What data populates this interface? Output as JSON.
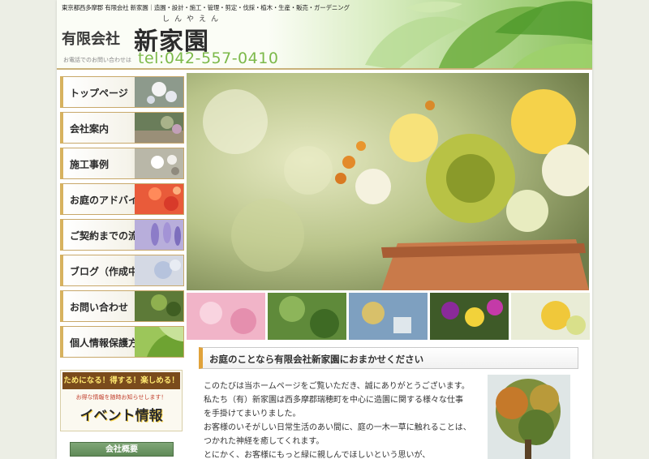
{
  "header": {
    "tagline": "東京都西多摩郡 有限会社 新家園｜造園・設計・施工・管理・剪定・伐採・植木・生産・販売・ガーデニング",
    "company_prefix": "有限会社",
    "company_name": "新家園",
    "furigana": "しんやえん",
    "tel_label": "お電話でのお問い合わせは",
    "tel_number": "tel:042-557-0410"
  },
  "nav": {
    "items": [
      {
        "label": "トップページ"
      },
      {
        "label": "会社案内"
      },
      {
        "label": "施工事例"
      },
      {
        "label": "お庭のアドバイス"
      },
      {
        "label": "ご契約までの流れ"
      },
      {
        "label": "ブログ（作成中）"
      },
      {
        "label": "お問い合わせ"
      },
      {
        "label": "個人情報保護方針"
      }
    ]
  },
  "banner": {
    "top": "ためになる！得する！楽しめる！",
    "mid": "お得な情報を随時お知らせします！",
    "main": "イベント情報"
  },
  "sidebar": {
    "section_heading": "会社概要"
  },
  "content": {
    "title": "お庭のことなら有限会社新家園におまかせください",
    "paragraphs": [
      "このたびは当ホームページをご覧いただき、誠にありがとうございます。",
      "私たち（有）新家園は西多摩郡瑞穂町を中心に造園に関する様々な仕事",
      "を手掛けてまいりました。",
      "お客様のいそがしい日常生活のあい間に、庭の一木一草に触れることは、",
      "つかれた神経を癒してくれます。",
      "とにかく、お客様にもっと緑に親しんでほしいという思いが、"
    ]
  },
  "colors": {
    "accent_gold": "#d7b25f",
    "tel_green": "#7cb94a",
    "heading_green": "#5f8a57"
  }
}
